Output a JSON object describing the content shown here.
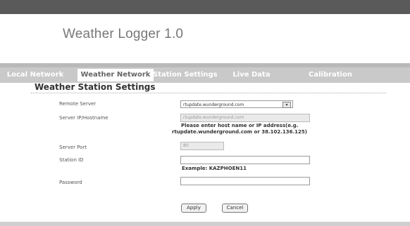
{
  "app": {
    "title": "Weather Logger 1.0"
  },
  "tabs": [
    {
      "label": "Local Network"
    },
    {
      "label": "Weather Network"
    },
    {
      "label": "Station Settings"
    },
    {
      "label": "Live Data"
    },
    {
      "label": "Calibration"
    }
  ],
  "active_tab": "Weather Network",
  "section": {
    "title": "Weather Station Settings"
  },
  "form": {
    "remote_server": {
      "label": "Remote Server",
      "value": "rtupdate.wunderground.com"
    },
    "server_ip": {
      "label": "Server IP/Hostname",
      "value": "rtupdate.wunderground.com",
      "hint_line1": "Please enter host name or IP address(e.g.",
      "hint_line2": "rtupdate.wunderground.com or 38.102.136.125)"
    },
    "server_port": {
      "label": "Server Port",
      "value": "80"
    },
    "station_id": {
      "label": "Station ID",
      "value": "",
      "hint": "Example: KAZPHOEN11"
    },
    "password": {
      "label": "Password",
      "value": ""
    }
  },
  "buttons": {
    "apply": "Apply",
    "cancel": "Cancel"
  },
  "colors": {
    "nav_bg": "#c9c9c9",
    "top_bar": "#5a5a5a",
    "tab_text": "#ffffff"
  }
}
